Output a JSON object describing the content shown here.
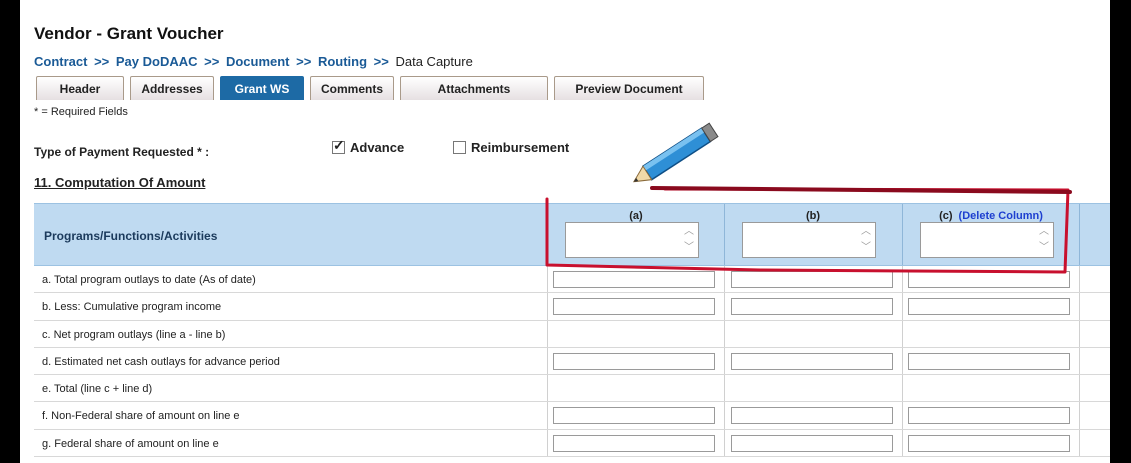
{
  "page": {
    "title": "Vendor - Grant Voucher",
    "breadcrumb": [
      {
        "label": "Contract",
        "link": true
      },
      {
        "label": "Pay DoDAAC",
        "link": true
      },
      {
        "label": "Document",
        "link": true
      },
      {
        "label": "Routing",
        "link": true
      },
      {
        "label": "Data Capture",
        "link": false
      }
    ],
    "breadcrumb_sep": ">>",
    "tabs": [
      {
        "label": "Header",
        "active": false
      },
      {
        "label": "Addresses",
        "active": false
      },
      {
        "label": "Grant WS",
        "active": true
      },
      {
        "label": "Comments",
        "active": false
      },
      {
        "label": "Attachments",
        "active": false
      },
      {
        "label": "Preview Document",
        "active": false
      }
    ],
    "required_note": "* = Required Fields"
  },
  "payment": {
    "label": "Type of Payment Requested * :",
    "advance_label": "Advance",
    "advance_checked": true,
    "reimbursement_label": "Reimbursement",
    "reimbursement_checked": false
  },
  "computation": {
    "section_title": "11. Computation Of Amount",
    "header_label": "Programs/Functions/Activities",
    "columns": [
      "(a)",
      "(b)",
      "(c)"
    ],
    "delete_column_label": "(Delete Column)",
    "rows": [
      {
        "label": "a. Total program outlays to date (As of date)",
        "inputs": true
      },
      {
        "label": "b. Less: Cumulative program income",
        "inputs": true
      },
      {
        "label": "c. Net program outlays (line a - line b)",
        "inputs": false
      },
      {
        "label": "d. Estimated net cash outlays for advance period",
        "inputs": true
      },
      {
        "label": "e. Total (line c + line d)",
        "inputs": false
      },
      {
        "label": "f. Non-Federal share of amount on line e",
        "inputs": true
      },
      {
        "label": "g. Federal share of amount on line e",
        "inputs": true
      }
    ]
  },
  "colors": {
    "brand_blue": "#1d6aa5",
    "header_band": "#bfdaf1",
    "link": "#1a5a96",
    "annotation_red": "#c8102e"
  },
  "icons": {
    "pencil": "pencil-icon",
    "spin_up": "chevron-up-icon",
    "spin_down": "chevron-down-icon",
    "checkbox_checked": "checkmark-icon"
  }
}
